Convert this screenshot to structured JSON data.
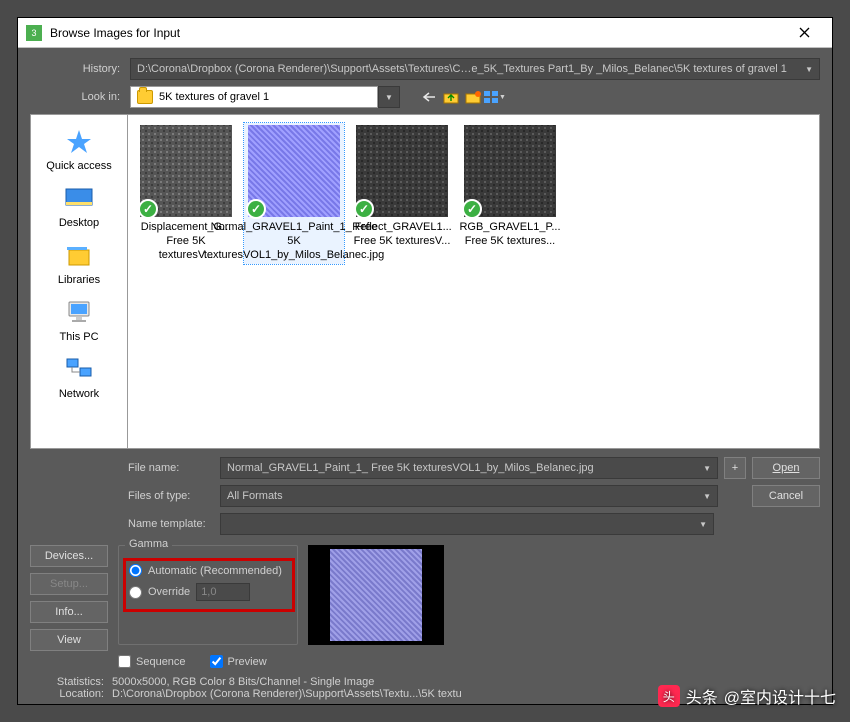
{
  "title": "Browse Images for Input",
  "history": {
    "label": "History:",
    "value": "D:\\Corona\\Dropbox (Corona Renderer)\\Support\\Assets\\Textures\\C…e_5K_Textures Part1_By _Milos_Belanec\\5K textures of gravel 1"
  },
  "lookin": {
    "label": "Look in:",
    "value": "5K textures of gravel 1"
  },
  "sidebar": {
    "items": [
      {
        "label": "Quick access"
      },
      {
        "label": "Desktop"
      },
      {
        "label": "Libraries"
      },
      {
        "label": "This PC"
      },
      {
        "label": "Network"
      }
    ]
  },
  "files": [
    {
      "caption": "Displacement_G... Free 5K texturesV..."
    },
    {
      "caption": "Normal_GRAVEL1_Paint_1_ Free 5K texturesVOL1_by_Milos_Belanec.jpg"
    },
    {
      "caption": "Reflect_GRAVEL1... Free 5K texturesV..."
    },
    {
      "caption": "RGB_GRAVEL1_P... Free 5K textures..."
    }
  ],
  "filename": {
    "label": "File name:",
    "value": "Normal_GRAVEL1_Paint_1_ Free 5K texturesVOL1_by_Milos_Belanec.jpg"
  },
  "filetype": {
    "label": "Files of type:",
    "value": "All Formats"
  },
  "nametpl": {
    "label": "Name template:",
    "value": ""
  },
  "plus": "+",
  "open": "Open",
  "cancel": "Cancel",
  "leftbtns": {
    "devices": "Devices...",
    "setup": "Setup...",
    "info": "Info...",
    "view": "View"
  },
  "gamma": {
    "legend": "Gamma",
    "auto": "Automatic (Recommended)",
    "override": "Override",
    "override_val": "1,0"
  },
  "sequence": "Sequence",
  "preview": "Preview",
  "stats": {
    "k1": "Statistics:",
    "v1": "5000x5000, RGB Color 8 Bits/Channel - Single Image",
    "k2": "Location:",
    "v2": "D:\\Corona\\Dropbox (Corona Renderer)\\Support\\Assets\\Textu...\\5K textu"
  },
  "watermark": {
    "prefix": "头条",
    "user": "@室内设计十七"
  }
}
